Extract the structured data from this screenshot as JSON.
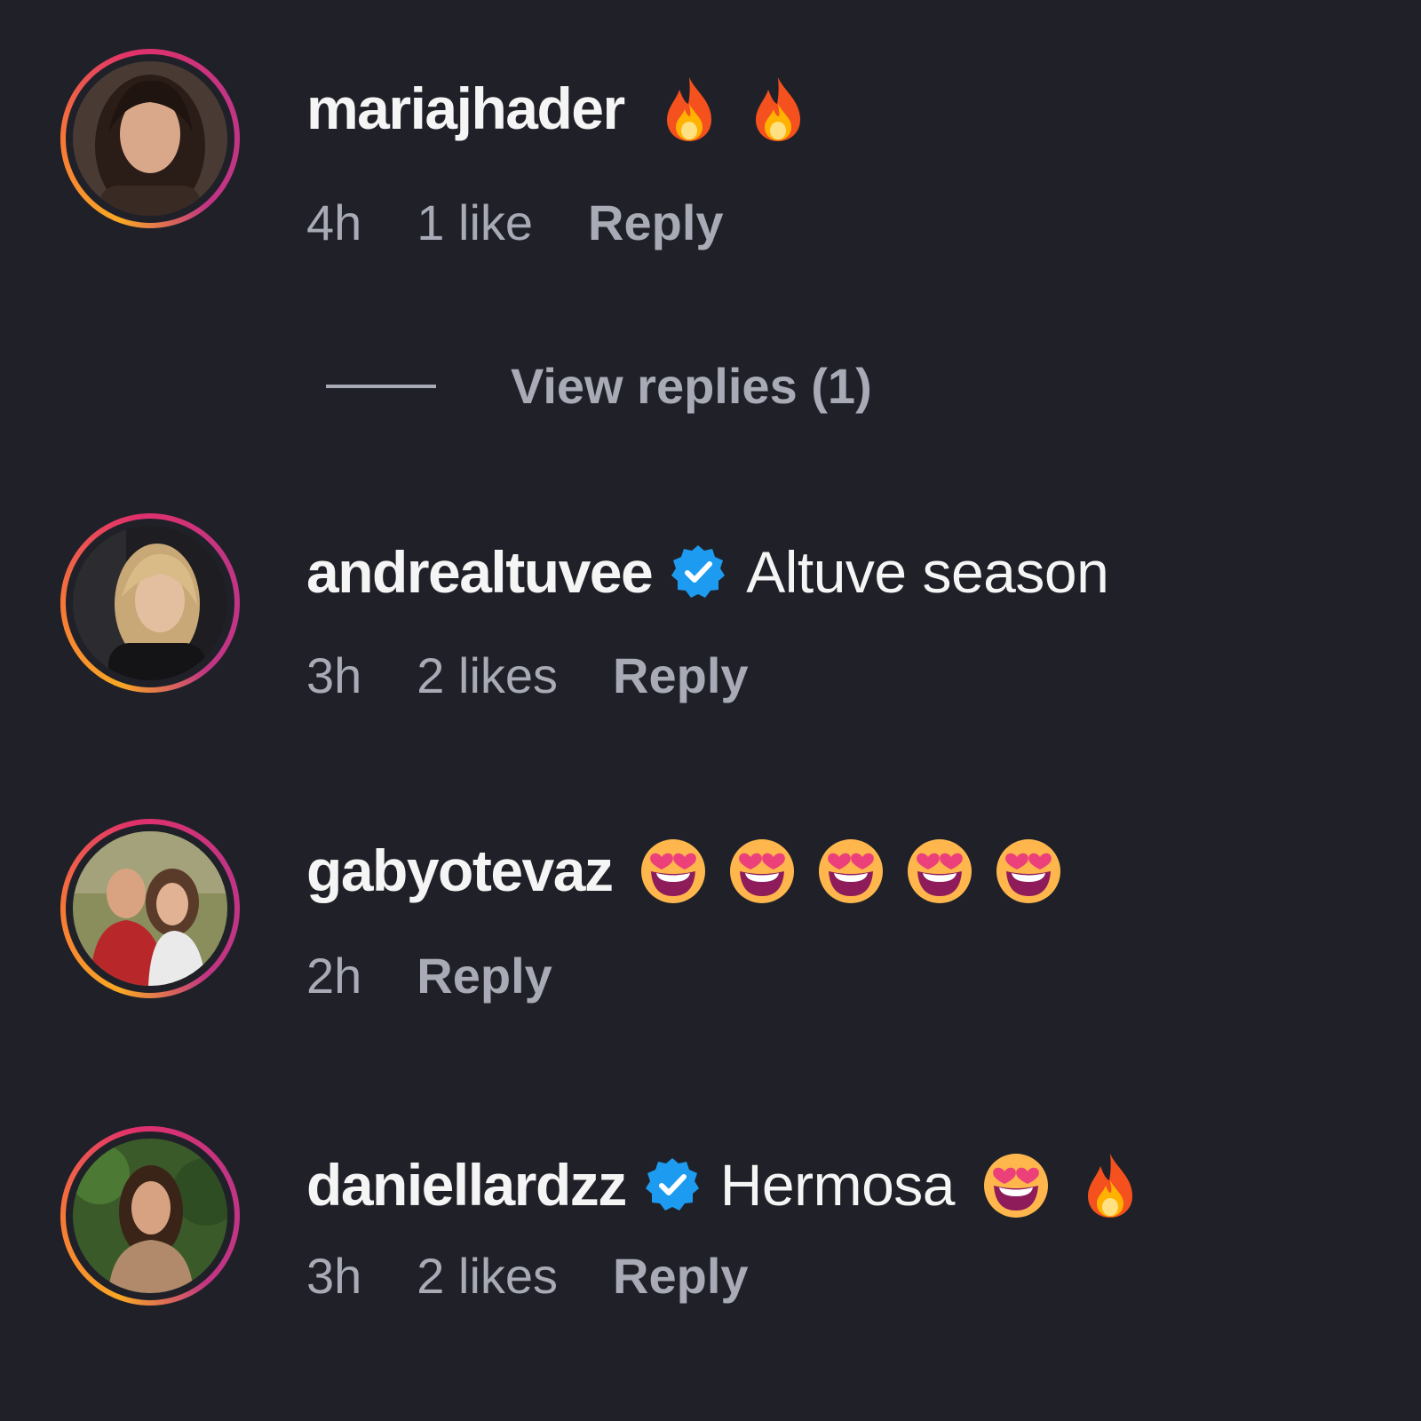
{
  "colors": {
    "background": "#202128",
    "primary_text": "#f5f5f5",
    "secondary_text": "#a8abb6",
    "verified_badge": "#1d9bf0",
    "story_ring_start": "#c13584",
    "story_ring_end": "#f9a825"
  },
  "comments": [
    {
      "username": "mariajhader",
      "verified": false,
      "text": "",
      "emojis": [
        "fire-emoji",
        "fire-emoji"
      ],
      "time": "4h",
      "likes": "1 like",
      "reply_label": "Reply",
      "view_replies": "View replies (1)"
    },
    {
      "username": "andrealtuvee",
      "verified": true,
      "text": "Altuve season",
      "emojis": [],
      "time": "3h",
      "likes": "2 likes",
      "reply_label": "Reply"
    },
    {
      "username": "gabyotevaz",
      "verified": false,
      "text": "",
      "emojis": [
        "heart-eyes-emoji",
        "heart-eyes-emoji",
        "heart-eyes-emoji",
        "heart-eyes-emoji",
        "heart-eyes-emoji"
      ],
      "time": "2h",
      "likes": "",
      "reply_label": "Reply"
    },
    {
      "username": "daniellardzz",
      "verified": true,
      "text": "Hermosa",
      "emojis": [
        "heart-eyes-emoji",
        "fire-emoji"
      ],
      "time": "3h",
      "likes": "2 likes",
      "reply_label": "Reply"
    }
  ]
}
